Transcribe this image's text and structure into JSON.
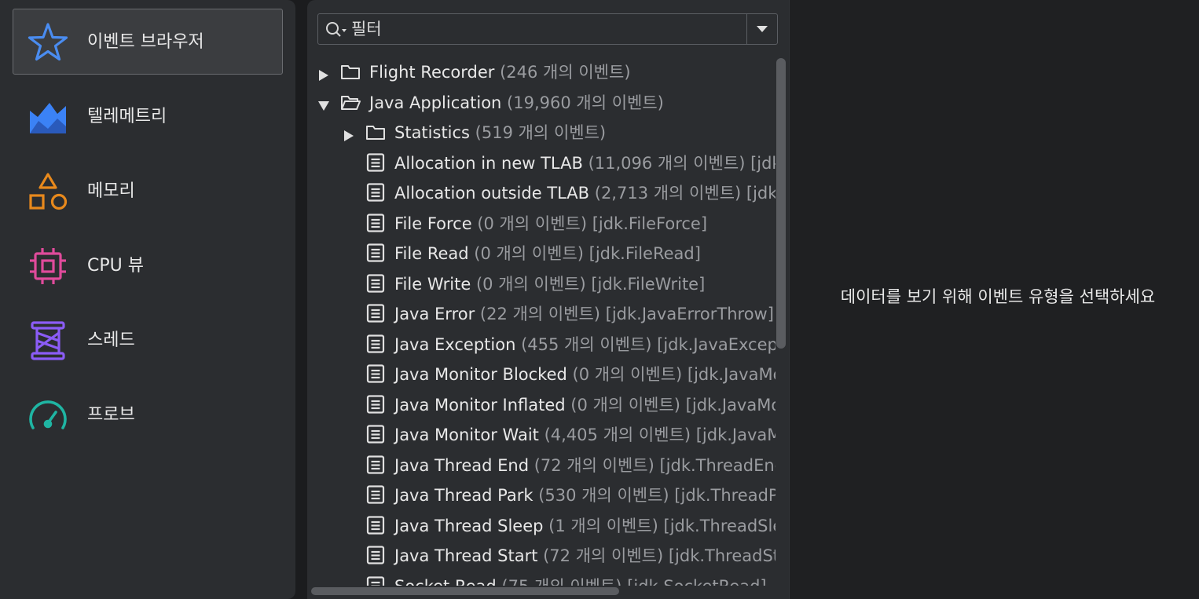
{
  "sidebar": {
    "items": [
      {
        "label": "이벤트 브라우저",
        "icon": "star-icon",
        "color": "#4a8cf0",
        "active": true
      },
      {
        "label": "텔레메트리",
        "icon": "telemetry-chart-icon",
        "color": "#3b82f6",
        "active": false
      },
      {
        "label": "메모리",
        "icon": "shapes-icon",
        "color": "#e8891c",
        "active": false
      },
      {
        "label": "CPU 뷰",
        "icon": "cpu-chip-icon",
        "color": "#e04b9b",
        "active": false
      },
      {
        "label": "스레드",
        "icon": "thread-spool-icon",
        "color": "#8b5cf6",
        "active": false
      },
      {
        "label": "프로브",
        "icon": "gauge-icon",
        "color": "#1fb5a3",
        "active": false
      }
    ]
  },
  "filter": {
    "placeholder": "필터"
  },
  "tree": {
    "rows": [
      {
        "type": "folder",
        "expanded": false,
        "depth": 0,
        "name": "Flight Recorder",
        "count": " (246 개의 이벤트)",
        "id": ""
      },
      {
        "type": "folder",
        "expanded": true,
        "depth": 0,
        "name": "Java Application",
        "count": " (19,960 개의 이벤트)",
        "id": ""
      },
      {
        "type": "folder",
        "expanded": false,
        "depth": 1,
        "name": "Statistics",
        "count": " (519 개의 이벤트)",
        "id": ""
      },
      {
        "type": "event",
        "depth": 1,
        "name": "Allocation in new TLAB",
        "count": " (11,096 개의 이벤트)",
        "id": " [jdk.ObjectAllocationInNewTLAB]"
      },
      {
        "type": "event",
        "depth": 1,
        "name": "Allocation outside TLAB",
        "count": " (2,713 개의 이벤트)",
        "id": " [jdk.ObjectAllocationOutsideTLAB]"
      },
      {
        "type": "event",
        "depth": 1,
        "name": "File Force",
        "count": " (0 개의 이벤트)",
        "id": " [jdk.FileForce]"
      },
      {
        "type": "event",
        "depth": 1,
        "name": "File Read",
        "count": " (0 개의 이벤트)",
        "id": " [jdk.FileRead]"
      },
      {
        "type": "event",
        "depth": 1,
        "name": "File Write",
        "count": " (0 개의 이벤트)",
        "id": " [jdk.FileWrite]"
      },
      {
        "type": "event",
        "depth": 1,
        "name": "Java Error",
        "count": " (22 개의 이벤트)",
        "id": " [jdk.JavaErrorThrow]"
      },
      {
        "type": "event",
        "depth": 1,
        "name": "Java Exception",
        "count": " (455 개의 이벤트)",
        "id": " [jdk.JavaExceptionThrow]"
      },
      {
        "type": "event",
        "depth": 1,
        "name": "Java Monitor Blocked",
        "count": " (0 개의 이벤트)",
        "id": " [jdk.JavaMonitorEnter]"
      },
      {
        "type": "event",
        "depth": 1,
        "name": "Java Monitor Inflated",
        "count": " (0 개의 이벤트)",
        "id": " [jdk.JavaMonitorInflate]"
      },
      {
        "type": "event",
        "depth": 1,
        "name": "Java Monitor Wait",
        "count": " (4,405 개의 이벤트)",
        "id": " [jdk.JavaMonitorWait]"
      },
      {
        "type": "event",
        "depth": 1,
        "name": "Java Thread End",
        "count": " (72 개의 이벤트)",
        "id": " [jdk.ThreadEnd]"
      },
      {
        "type": "event",
        "depth": 1,
        "name": "Java Thread Park",
        "count": " (530 개의 이벤트)",
        "id": " [jdk.ThreadPark]"
      },
      {
        "type": "event",
        "depth": 1,
        "name": "Java Thread Sleep",
        "count": " (1 개의 이벤트)",
        "id": " [jdk.ThreadSleep]"
      },
      {
        "type": "event",
        "depth": 1,
        "name": "Java Thread Start",
        "count": " (72 개의 이벤트)",
        "id": " [jdk.ThreadStart]"
      },
      {
        "type": "event",
        "depth": 1,
        "name": "Socket Read",
        "count": " (75 개의 이벤트)",
        "id": " [jdk.SocketRead]"
      }
    ]
  },
  "detail": {
    "message": "데이터를 보기 위해 이벤트 유형을 선택하세요"
  }
}
